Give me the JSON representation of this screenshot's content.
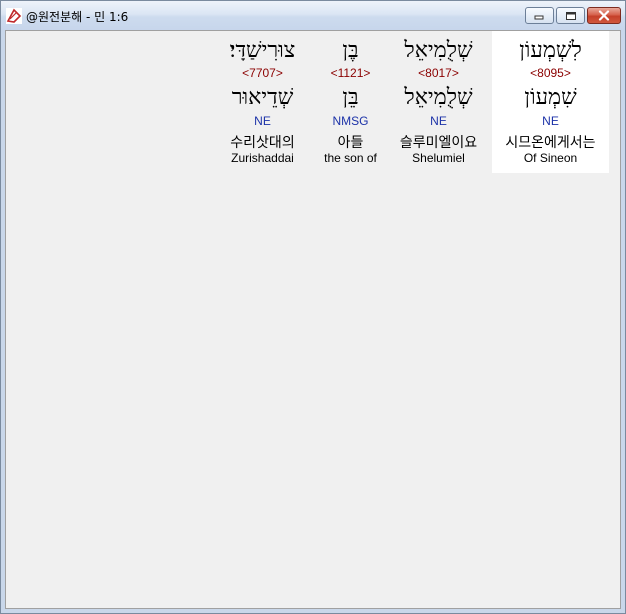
{
  "window": {
    "title": "@원전분해 - 민 1:6"
  },
  "words": [
    {
      "hebrew": "לִשְׁמְעוֹן",
      "strong": "<8095>",
      "lemma": "שִׁמְעוֹן",
      "morph": "NE",
      "korean": "시므온에게서는",
      "english": "Of Sineon"
    },
    {
      "hebrew": "שְׁלֻמִיאֵל",
      "strong": "<8017>",
      "lemma": "שְׁלֻמִיאֵל",
      "morph": "NE",
      "korean": "슬루미엘이요",
      "english": "Shelumiel"
    },
    {
      "hebrew": "בֶּן",
      "strong": "<1121>",
      "lemma": "בֵּן",
      "morph": "NMSG",
      "korean": "아들",
      "english": "the son of"
    },
    {
      "hebrew": "צוּרִישַׁדָּי׃",
      "strong": "<7707>",
      "lemma": "שְׁדֵיאוּר",
      "morph": "NE",
      "korean": "수리삿대의",
      "english": "Zurishaddai"
    }
  ],
  "colors": {
    "strong": "#8b0000",
    "morph": "#1c32a8",
    "selected_bg": "#ffffff"
  }
}
